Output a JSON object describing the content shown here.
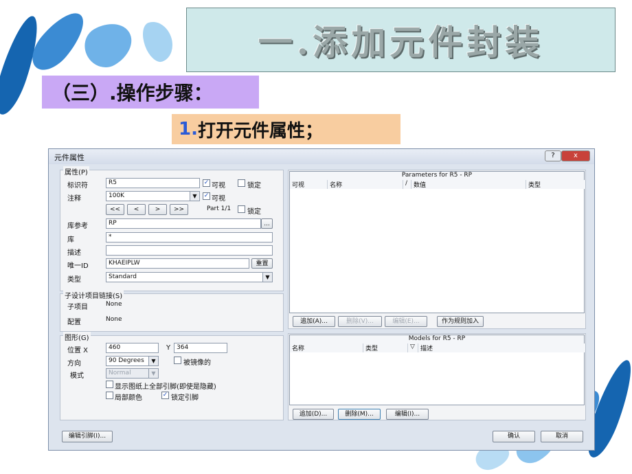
{
  "slide": {
    "title": "一.添加元件封装",
    "step_heading": "（三）.操作步骤：",
    "step1_num": "1.",
    "step1_text": "打开元件属性；"
  },
  "dialog": {
    "title": "元件属性",
    "help_btn": "?",
    "close_btn": "x",
    "properties": {
      "group_label": "属性(P)",
      "designator_label": "标识符",
      "designator_value": "R5",
      "designator_visible": "可视",
      "designator_lock": "锁定",
      "comment_label": "注释",
      "comment_value": "100K",
      "comment_visible": "可视",
      "nav_buttons": [
        "<<",
        "<",
        ">",
        ">>"
      ],
      "part_label": "Part 1/1",
      "part_lock": "锁定",
      "libref_label": "库参考",
      "libref_value": "RP",
      "libref_browse": "...",
      "library_label": "库",
      "library_value": "*",
      "desc_label": "描述",
      "desc_value": "",
      "uid_label": "唯一ID",
      "uid_value": "KHAEIPLW",
      "uid_reset": "重置",
      "type_label": "类型",
      "type_value": "Standard"
    },
    "subdesign": {
      "group_label": "子设计项目链接(S)",
      "subproject_label": "子项目",
      "subproject_value": "None",
      "config_label": "配置",
      "config_value": "None"
    },
    "graphical": {
      "group_label": "图形(G)",
      "posx_label": "位置 X",
      "posx_value": "460",
      "y_label": "Y",
      "y_value": "364",
      "orient_label": "方向",
      "orient_value": "90 Degrees",
      "mirrored_label": "被镜像的",
      "mode_label": "模式",
      "mode_value": "Normal",
      "show_hidden_pins": "显示图纸上全部引脚(即使是隐藏)",
      "local_colors": "局部颜色",
      "lock_pins": "锁定引脚"
    },
    "parameters": {
      "title": "Parameters for R5 - RP",
      "columns": [
        "可视",
        "名称",
        "/",
        "数值",
        "类型"
      ],
      "buttons": [
        "追加(A)...",
        "删除(V)...",
        "编辑(E)...",
        "作为规则加入"
      ]
    },
    "models": {
      "title": "Models for R5 - RP",
      "columns": [
        "名称",
        "类型",
        "▽",
        "描述"
      ],
      "buttons": [
        "追加(D)...",
        "删除(M)...",
        "编辑(I)..."
      ]
    },
    "footer": {
      "edit_pins": "编辑引脚(I)...",
      "ok": "确认",
      "cancel": "取消"
    }
  }
}
